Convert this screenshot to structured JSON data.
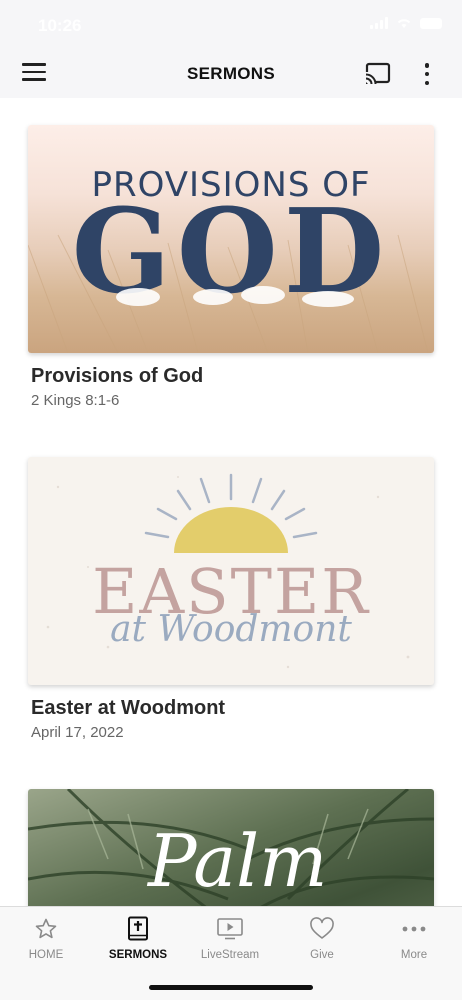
{
  "status_bar": {
    "time": "10:26"
  },
  "app_bar": {
    "title": "SERMONS",
    "menu_icon": "hamburger-menu-icon",
    "cast_icon": "cast-icon",
    "more_icon": "more-vertical-icon"
  },
  "sermons": [
    {
      "title": "Provisions of God",
      "subtitle": "2 Kings 8:1-6",
      "art": {
        "line1": "PROVISIONS OF",
        "line2": "GOD"
      }
    },
    {
      "title": "Easter at Woodmont",
      "subtitle": "April 17, 2022",
      "art": {
        "line1": "EASTER",
        "line2": "at Woodmont"
      }
    },
    {
      "title": "",
      "subtitle": "",
      "art": {
        "line1": "Palm"
      }
    }
  ],
  "bottom_nav": [
    {
      "label": "HOME",
      "icon": "star-icon",
      "active": false
    },
    {
      "label": "SERMONS",
      "icon": "bible-icon",
      "active": true
    },
    {
      "label": "LiveStream",
      "icon": "video-play-icon",
      "active": false
    },
    {
      "label": "Give",
      "icon": "heart-icon",
      "active": false
    },
    {
      "label": "More",
      "icon": "more-horizontal-icon",
      "active": false
    }
  ],
  "colors": {
    "navy_text": "#2f4466",
    "mauve_text": "#c4a3a0",
    "sun_yellow": "#e3cd6b",
    "script_blue": "#9aaac0"
  }
}
